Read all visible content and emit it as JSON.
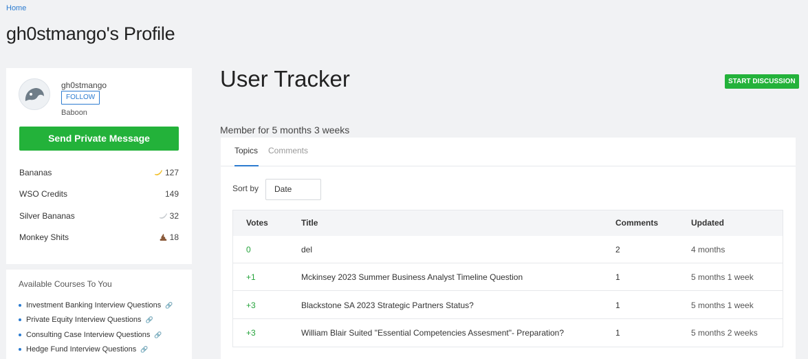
{
  "breadcrumb": "Home",
  "page_title": "gh0stmango's Profile",
  "profile": {
    "username": "gh0stmango",
    "follow_label": "FOLLOW",
    "rank": "Baboon",
    "send_pm_label": "Send Private Message",
    "stats": [
      {
        "label": "Bananas",
        "value": "127",
        "icon": "banana-icon"
      },
      {
        "label": "WSO Credits",
        "value": "149",
        "icon": ""
      },
      {
        "label": "Silver Bananas",
        "value": "32",
        "icon": "silver-banana-icon"
      },
      {
        "label": "Monkey Shits",
        "value": "18",
        "icon": "monkey-shit-icon"
      }
    ]
  },
  "courses": {
    "title": "Available Courses To You",
    "items": [
      "Investment Banking Interview Questions",
      "Private Equity Interview Questions",
      "Consulting Case Interview Questions",
      "Hedge Fund Interview Questions"
    ]
  },
  "main": {
    "title": "User Tracker",
    "start_discussion_label": "START DISCUSSION",
    "member_for": "Member for 5 months 3 weeks",
    "tabs": [
      "Topics",
      "Comments"
    ],
    "sort_by_label": "Sort by",
    "sort_by_value": "Date",
    "table": {
      "headers": [
        "Votes",
        "Title",
        "Comments",
        "Updated"
      ],
      "rows": [
        {
          "votes": "0",
          "title": "del",
          "comments": "2",
          "updated": "4 months"
        },
        {
          "votes": "+1",
          "title": "Mckinsey 2023 Summer Business Analyst Timeline Question",
          "comments": "1",
          "updated": "5 months 1 week"
        },
        {
          "votes": "+3",
          "title": "Blackstone SA 2023 Strategic Partners Status?",
          "comments": "1",
          "updated": "5 months 1 week"
        },
        {
          "votes": "+3",
          "title": "William Blair Suited \"Essential Competencies Assesment\"- Preparation?",
          "comments": "1",
          "updated": "5 months 2 weeks"
        }
      ]
    }
  },
  "colors": {
    "accent": "#2b7bd0",
    "green": "#23b23a",
    "vote_green": "#23a33a"
  }
}
